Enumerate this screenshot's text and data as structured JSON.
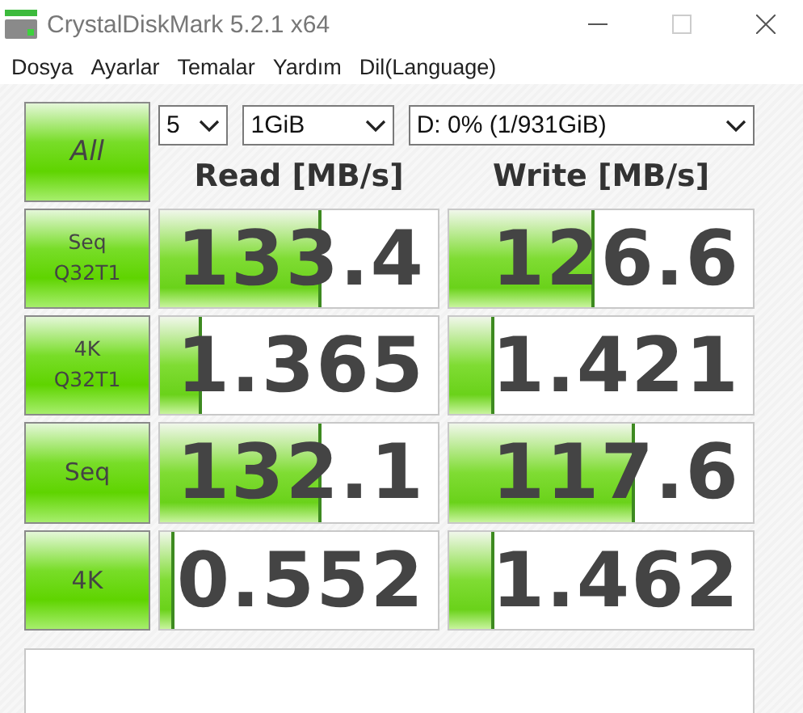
{
  "window": {
    "title": "CrystalDiskMark 5.2.1 x64"
  },
  "menu": [
    "Dosya",
    "Ayarlar",
    "Temalar",
    "Yardım",
    "Dil(Language)"
  ],
  "all_button": "All",
  "selects": [
    {
      "value": "5"
    },
    {
      "value": "1GiB"
    },
    {
      "value": "D: 0% (1/931GiB)"
    }
  ],
  "headers": [
    "Read [MB/s]",
    "Write [MB/s]"
  ],
  "rows": [
    {
      "label": "Seq\nQ32T1",
      "read": {
        "value": "133.4",
        "level": 0.57
      },
      "write": {
        "value": "126.6",
        "level": 0.47
      }
    },
    {
      "label": "4K\nQ32T1",
      "read": {
        "value": "1.365",
        "level": 0.14
      },
      "write": {
        "value": "1.421",
        "level": 0.14
      }
    },
    {
      "label": "Seq",
      "read": {
        "value": "132.1",
        "level": 0.57
      },
      "write": {
        "value": "117.6",
        "level": 0.6
      }
    },
    {
      "label": "4K",
      "read": {
        "value": "0.552",
        "level": 0.04
      },
      "write": {
        "value": "1.462",
        "level": 0.14
      }
    }
  ]
}
